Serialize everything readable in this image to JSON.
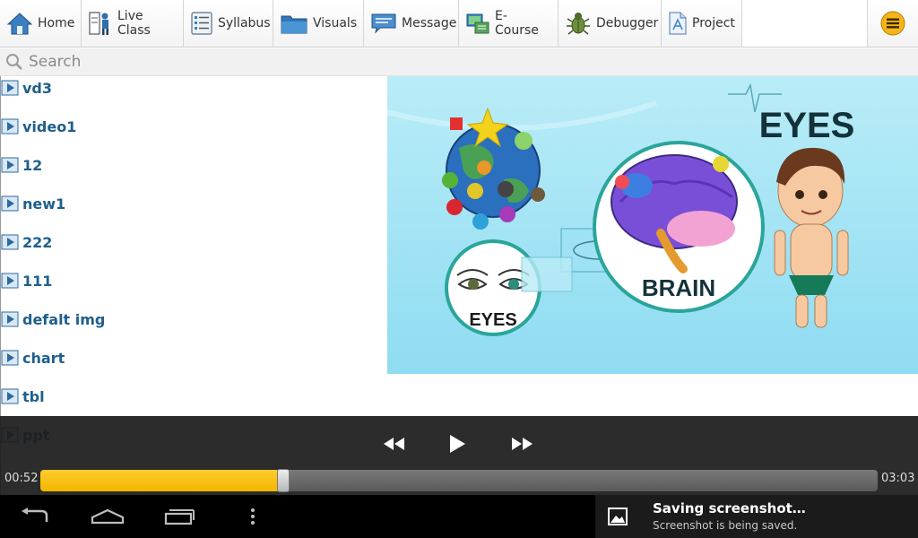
{
  "toolbar": {
    "items": [
      {
        "label": "Home",
        "icon": "home-icon"
      },
      {
        "label": "Live Class",
        "icon": "presenter-icon"
      },
      {
        "label": "Syllabus",
        "icon": "list-icon"
      },
      {
        "label": "Visuals",
        "icon": "folder-icon"
      },
      {
        "label": "Message",
        "icon": "message-icon"
      },
      {
        "label": "E-Course",
        "icon": "ecourse-icon"
      },
      {
        "label": "Debugger",
        "icon": "bug-icon"
      },
      {
        "label": "Project",
        "icon": "document-icon"
      }
    ],
    "menu_icon": "hamburger-icon",
    "menu_color": "#f5b51a"
  },
  "search": {
    "placeholder": "Search"
  },
  "files": [
    {
      "name": "vd3"
    },
    {
      "name": "video1"
    },
    {
      "name": "12"
    },
    {
      "name": "new1"
    },
    {
      "name": "222"
    },
    {
      "name": "111"
    },
    {
      "name": "defalt img"
    },
    {
      "name": "chart"
    },
    {
      "name": "tbl"
    },
    {
      "name": "ppt"
    }
  ],
  "preview": {
    "eyes_heading": "EYES",
    "eyes_circle_label": "EYES",
    "brain_label": "BRAIN"
  },
  "player": {
    "elapsed": "00:52",
    "total": "03:03",
    "progress": 0.29,
    "accent": "#f5b800"
  },
  "notification": {
    "title": "Saving screenshot…",
    "subtitle": "Screenshot is being saved."
  }
}
